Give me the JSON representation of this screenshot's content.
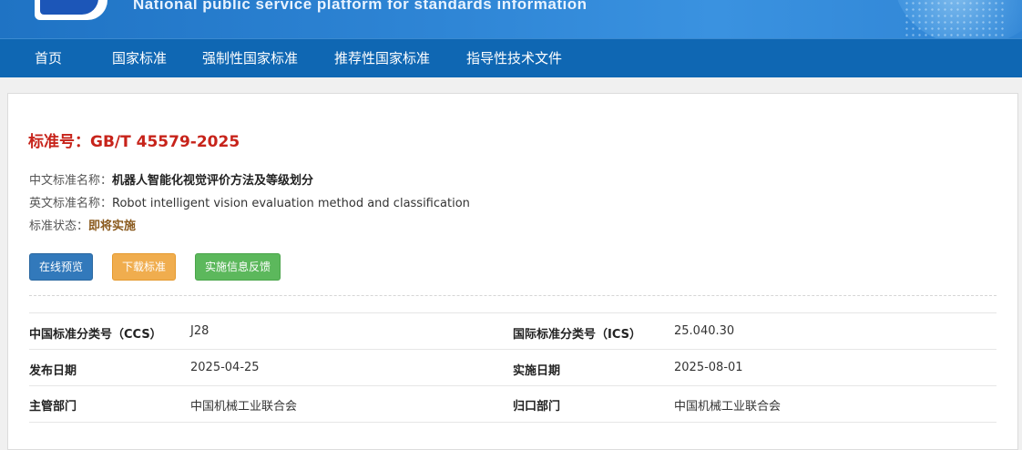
{
  "banner": {
    "subtitle": "National public service platform  for standards information"
  },
  "nav": {
    "items": [
      {
        "label": "首页"
      },
      {
        "label": "国家标准"
      },
      {
        "label": "强制性国家标准"
      },
      {
        "label": "推荐性国家标准"
      },
      {
        "label": "指导性技术文件"
      }
    ]
  },
  "standard": {
    "title": "标准号：GB/T 45579-2025",
    "cn_name_label": "中文标准名称：",
    "cn_name": "机器人智能化视觉评价方法及等级划分",
    "en_name_label": "英文标准名称：",
    "en_name": "Robot intelligent vision evaluation method and classification",
    "status_label": "标准状态：",
    "status": "即将实施"
  },
  "buttons": {
    "preview": "在线预览",
    "download": "下载标准",
    "feedback": "实施信息反馈"
  },
  "details": {
    "rows": [
      {
        "l1": "中国标准分类号（CCS）",
        "v1": "J28",
        "l2": "国际标准分类号（ICS）",
        "v2": "25.040.30"
      },
      {
        "l1": "发布日期",
        "v1": "2025-04-25",
        "l2": "实施日期",
        "v2": "2025-08-01"
      },
      {
        "l1": "主管部门",
        "v1": "中国机械工业联合会",
        "l2": "归口部门",
        "v2": "中国机械工业联合会"
      }
    ]
  },
  "colors": {
    "banner": "#2f86d6",
    "nav": "#0f67b3",
    "title_red": "#c7231a",
    "btn_blue": "#3279bb",
    "btn_orange": "#f0ad4e",
    "btn_green": "#5cb85c"
  }
}
